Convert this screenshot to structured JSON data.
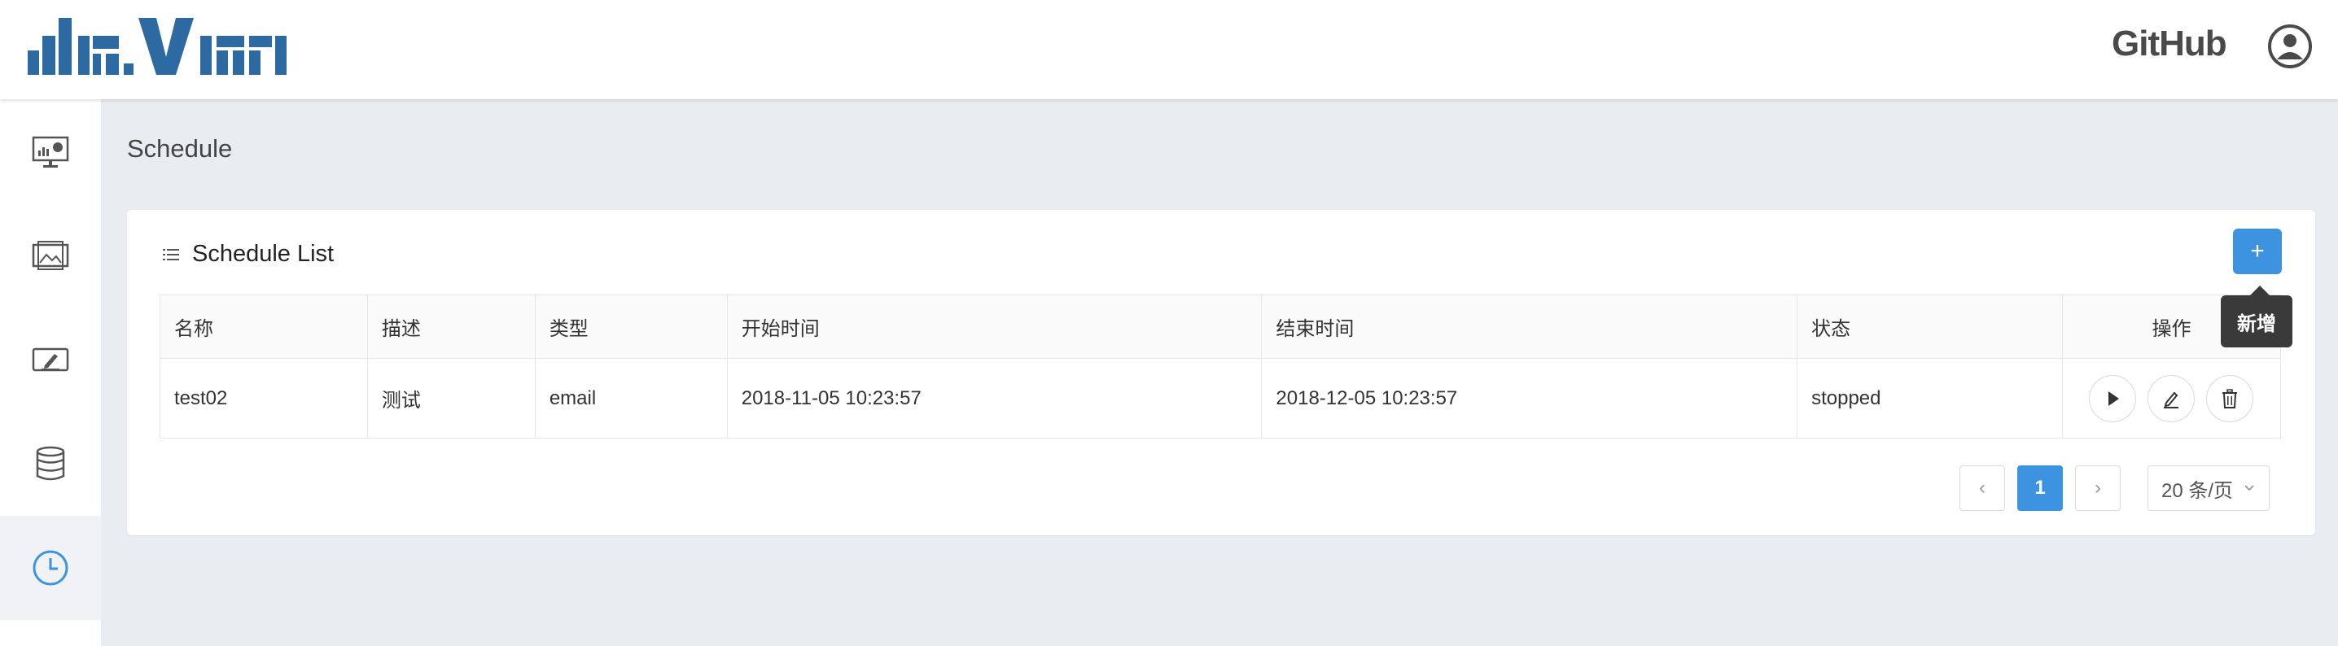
{
  "header": {
    "logo_text": "davinci",
    "github_label": "GitHub"
  },
  "sidebar": {
    "items": [
      {
        "name": "dashboard"
      },
      {
        "name": "display"
      },
      {
        "name": "widget"
      },
      {
        "name": "source"
      },
      {
        "name": "schedule",
        "active": true
      }
    ]
  },
  "page": {
    "title": "Schedule"
  },
  "card": {
    "title": "Schedule List",
    "add_button_label": "+",
    "add_tooltip": "新增"
  },
  "table": {
    "columns": [
      "名称",
      "描述",
      "类型",
      "开始时间",
      "结束时间",
      "状态",
      "操作"
    ],
    "rows": [
      {
        "name": "test02",
        "description": "测试",
        "type": "email",
        "start_time": "2018-11-05 10:23:57",
        "end_time": "2018-12-05 10:23:57",
        "status": "stopped"
      }
    ]
  },
  "pagination": {
    "prev": "‹",
    "current": "1",
    "next": "›",
    "page_size": "20 条/页"
  },
  "colors": {
    "accent": "#3d93df",
    "logo": "#2d6aa1",
    "background": "#e9ecf1"
  }
}
